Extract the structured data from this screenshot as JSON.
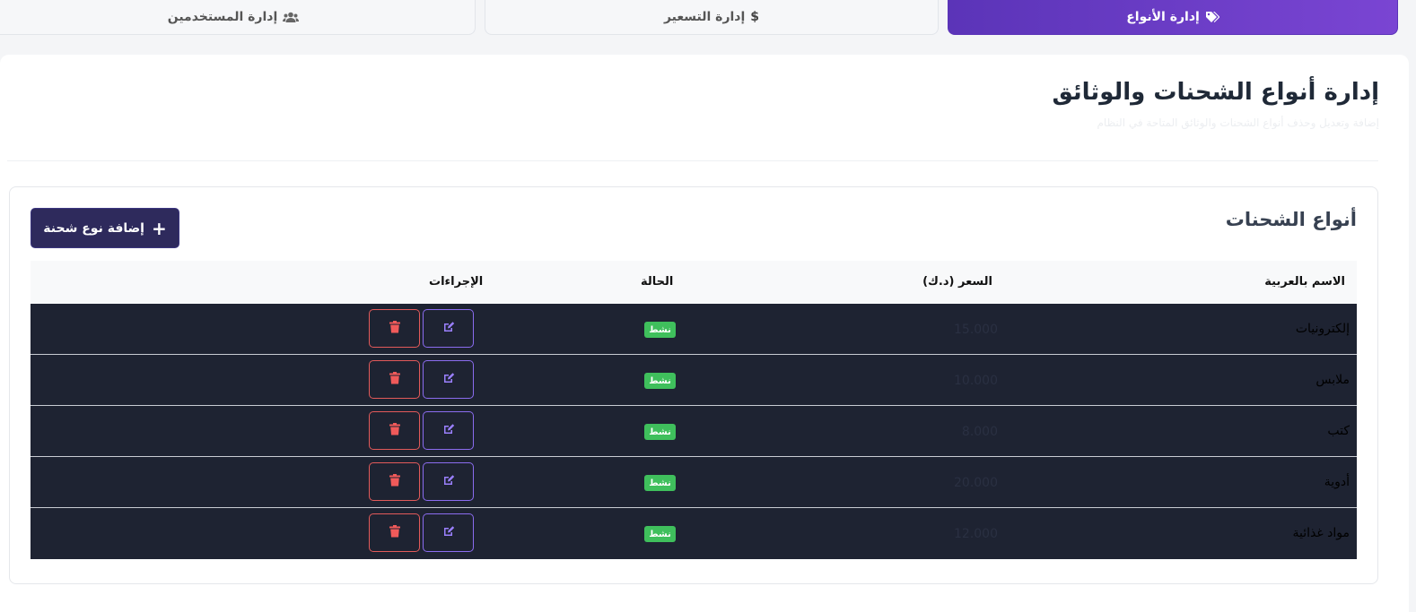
{
  "tabs": [
    {
      "label": "إدارة الأنواع",
      "icon": "tags-icon",
      "active": true
    },
    {
      "label": "إدارة التسعير",
      "icon": "dollar-icon",
      "active": false
    },
    {
      "label": "إدارة المستخدمين",
      "icon": "users-icon",
      "active": false
    }
  ],
  "page": {
    "title": "إدارة أنواع الشحنات والوثائق",
    "subtitle": "إضافة وتعديل وحذف أنواع الشحنات والوثائق المتاحة في النظام"
  },
  "card": {
    "title": "أنواع الشحنات",
    "add_button": "إضافة نوع شحنة"
  },
  "table": {
    "headers": {
      "name": "الاسم بالعربية",
      "price": "السعر (د.ك)",
      "status": "الحالة",
      "actions": "الإجراءات"
    },
    "rows": [
      {
        "name": "إلكترونيات",
        "price": "15.000",
        "status": "نشط"
      },
      {
        "name": "ملابس",
        "price": "10.000",
        "status": "نشط"
      },
      {
        "name": "كتب",
        "price": "8.000",
        "status": "نشط"
      },
      {
        "name": "أدوية",
        "price": "20.000",
        "status": "نشط"
      },
      {
        "name": "مواد غذائية",
        "price": "12.000",
        "status": "نشط"
      }
    ]
  },
  "colors": {
    "accent": "#6a3cc8",
    "row_bg": "#1e2332",
    "status_green": "#3fbf5c",
    "delete_red": "#e35a5a",
    "edit_purple": "#8b6cf0"
  }
}
